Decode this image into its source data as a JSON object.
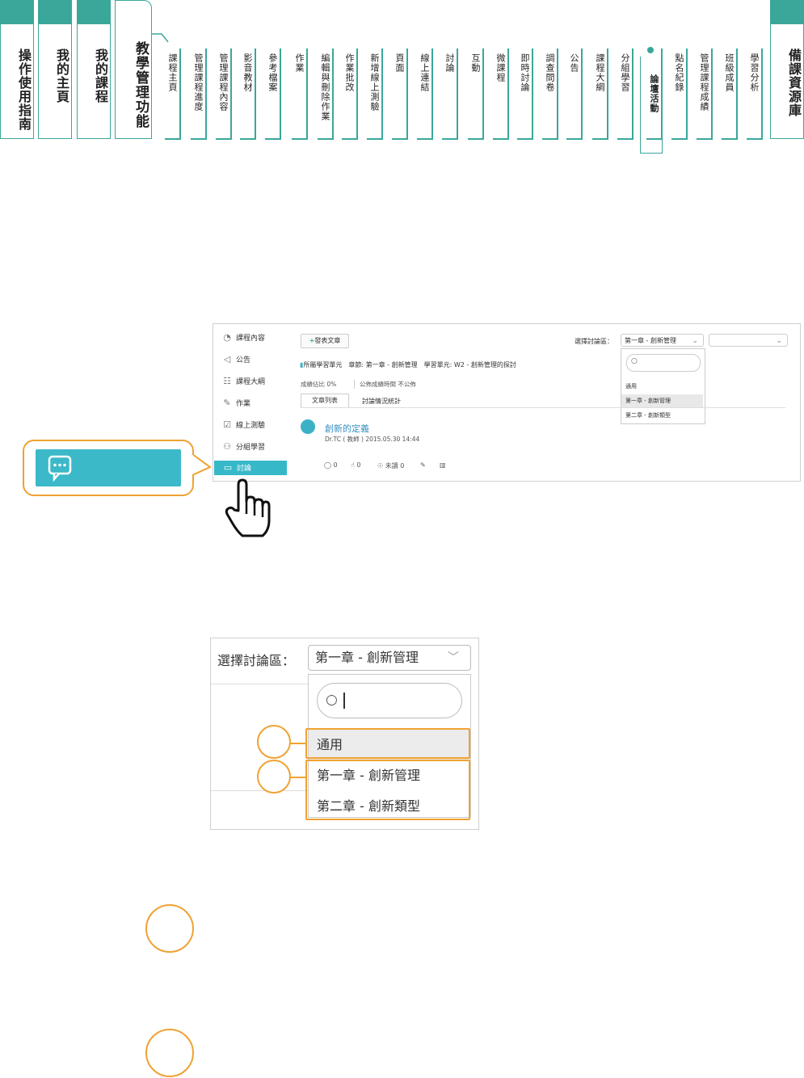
{
  "nav": {
    "main_tabs": [
      {
        "label": "操作使用指南"
      },
      {
        "label": "我的主頁"
      },
      {
        "label": "我的課程"
      },
      {
        "label": "教學管理功能"
      },
      {
        "label": "備課資源庫"
      }
    ],
    "sub_items": [
      {
        "label": "課程主頁"
      },
      {
        "label": "管理課程進度"
      },
      {
        "label": "管理課程內容"
      },
      {
        "label": "影音教材"
      },
      {
        "label": "參考檔案"
      },
      {
        "label": "作業"
      },
      {
        "label": "編輯與刪除作業"
      },
      {
        "label": "作業批改"
      },
      {
        "label": "新增線上測驗"
      },
      {
        "label": "頁面"
      },
      {
        "label": "線上連結"
      },
      {
        "label": "討論"
      },
      {
        "label": "互動"
      },
      {
        "label": "微課程"
      },
      {
        "label": "即時討論"
      },
      {
        "label": "調查問卷"
      },
      {
        "label": "公告"
      },
      {
        "label": "課程大綱"
      },
      {
        "label": "分組學習"
      },
      {
        "label": "論壇活動"
      },
      {
        "label": "點名紀錄"
      },
      {
        "label": "管理課程成績"
      },
      {
        "label": "班級成員"
      },
      {
        "label": "學習分析"
      }
    ],
    "active_sub": "論壇活動"
  },
  "screenshot1": {
    "sidebar": [
      {
        "label": "課程內容",
        "icon": "course-content-icon"
      },
      {
        "label": "公告",
        "icon": "megaphone-icon"
      },
      {
        "label": "課程大綱",
        "icon": "outline-icon"
      },
      {
        "label": "作業",
        "icon": "assignment-icon"
      },
      {
        "label": "線上測驗",
        "icon": "quiz-icon"
      },
      {
        "label": "分組學習",
        "icon": "group-icon"
      },
      {
        "label": "討論",
        "icon": "chat-icon"
      }
    ],
    "post_button": "發表文章",
    "select_label": "選擇討論區：",
    "select_value": "第一章 - 創新管理",
    "menu_options": [
      "通用",
      "第一章 - 創新管理",
      "第二章 - 創新類型"
    ],
    "breadcrumb": "所屬學習單元　章節: 第一章 - 創新管理　學習單元: W2 - 創新管理的探討",
    "grade_ratio": "成績佔比 0%",
    "grade_publish": "公佈成績時間 不公佈",
    "tabs": [
      "文章列表",
      "討論情況統計"
    ],
    "post_title": "創新的定義",
    "post_meta": "Dr.TC ( 教師 ) 2015.05.30 14:44",
    "stats": {
      "comments": "0",
      "likes": "0",
      "unread": "未讀 0"
    }
  },
  "screenshot2": {
    "select_label": "選擇討論區：",
    "select_value": "第一章 - 創新管理",
    "options": [
      "通用",
      "第一章 - 創新管理",
      "第二章 - 創新類型"
    ]
  },
  "colors": {
    "accent_green": "#3aa79a",
    "orange": "#efa232",
    "cyan": "#3bb9c8"
  }
}
